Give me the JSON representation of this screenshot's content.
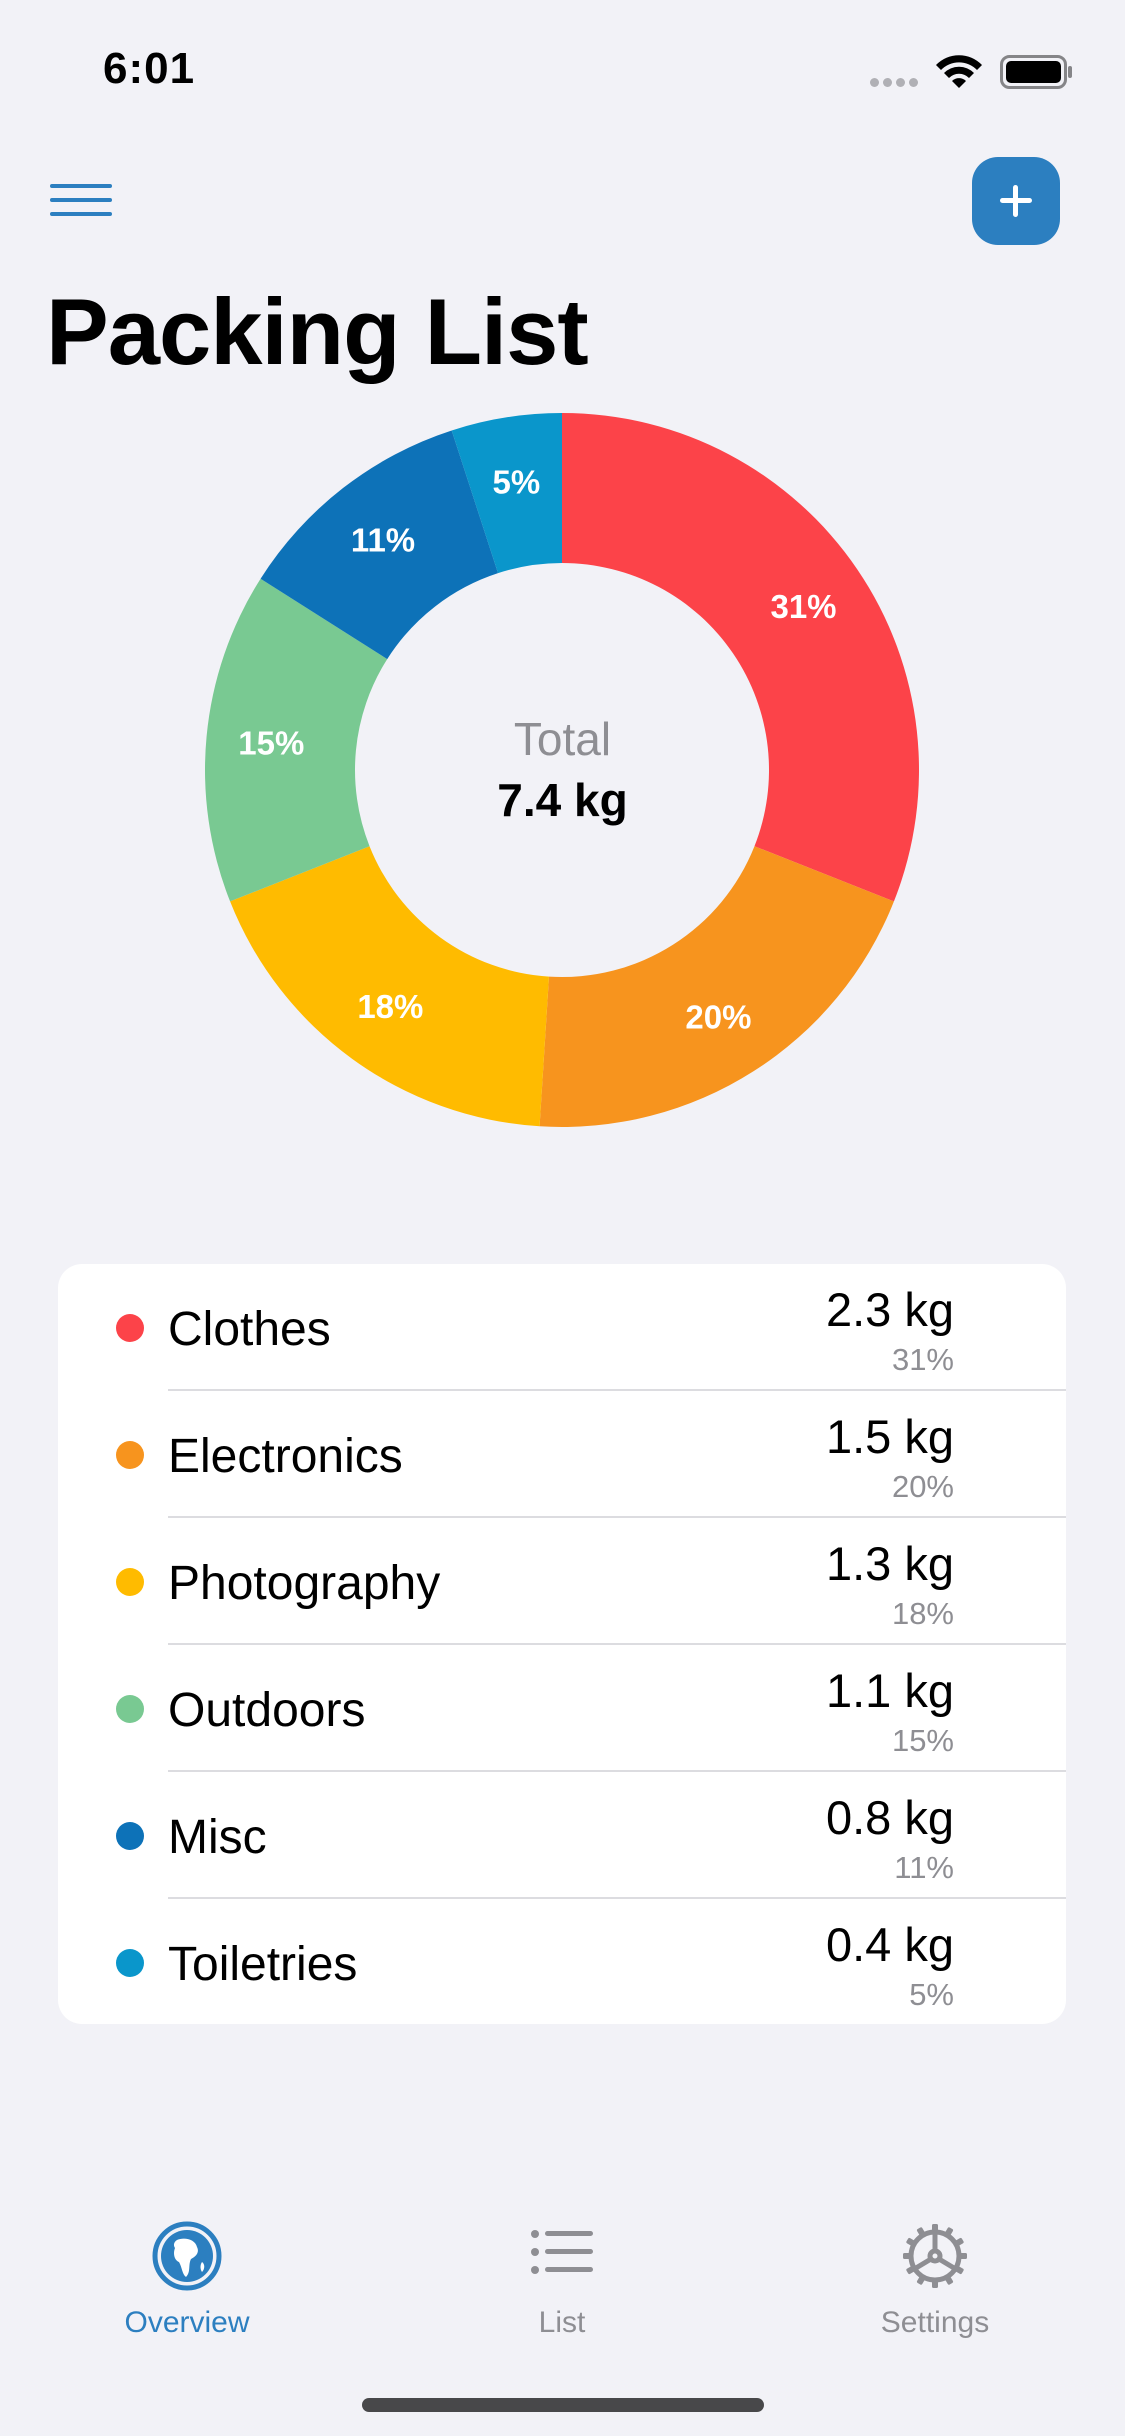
{
  "status_bar": {
    "time": "6:01"
  },
  "header": {
    "title": "Packing List"
  },
  "chart_data": {
    "type": "pie",
    "donut": true,
    "center_label": "Total",
    "center_value": "7.4 kg",
    "categories": [
      "Clothes",
      "Electronics",
      "Photography",
      "Outdoors",
      "Misc",
      "Toiletries"
    ],
    "values": [
      31,
      20,
      18,
      15,
      11,
      5
    ],
    "labels": [
      "31%",
      "20%",
      "18%",
      "15%",
      "11%",
      "5%"
    ],
    "colors": [
      "#fc4349",
      "#f7941e",
      "#ffbb00",
      "#79c992",
      "#0d72b8",
      "#0a96cb"
    ]
  },
  "categories": [
    {
      "name": "Clothes",
      "weight": "2.3 kg",
      "percent": "31%",
      "color": "#fc4349"
    },
    {
      "name": "Electronics",
      "weight": "1.5 kg",
      "percent": "20%",
      "color": "#f7941e"
    },
    {
      "name": "Photography",
      "weight": "1.3 kg",
      "percent": "18%",
      "color": "#ffbb00"
    },
    {
      "name": "Outdoors",
      "weight": "1.1 kg",
      "percent": "15%",
      "color": "#79c992"
    },
    {
      "name": "Misc",
      "weight": "0.8 kg",
      "percent": "11%",
      "color": "#0d72b8"
    },
    {
      "name": "Toiletries",
      "weight": "0.4 kg",
      "percent": "5%",
      "color": "#0a96cb"
    }
  ],
  "tab_bar": {
    "tabs": [
      {
        "label": "Overview",
        "icon": "globe-icon",
        "active": true
      },
      {
        "label": "List",
        "icon": "list-icon",
        "active": false
      },
      {
        "label": "Settings",
        "icon": "gear-icon",
        "active": false
      }
    ],
    "accent": "#2c7fc0",
    "inactive": "#8e8e93"
  }
}
